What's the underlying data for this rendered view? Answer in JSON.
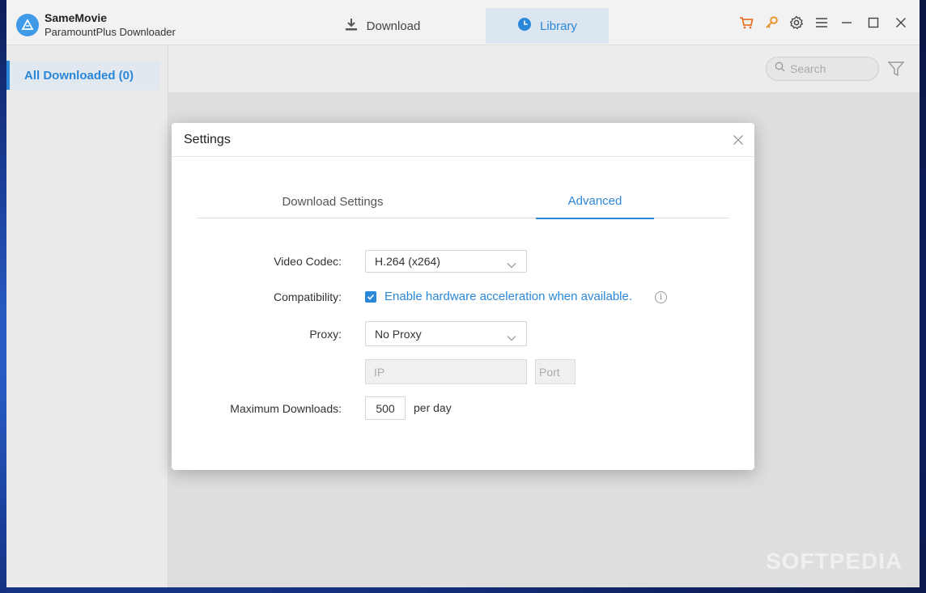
{
  "app": {
    "name": "SameMovie",
    "subtitle": "ParamountPlus Downloader"
  },
  "nav": {
    "download": "Download",
    "library": "Library"
  },
  "toolbar_icons": [
    "cart-icon",
    "key-icon",
    "gear-icon",
    "menu-icon",
    "minimize-icon",
    "maximize-icon",
    "close-icon"
  ],
  "sidebar": {
    "all_downloaded": "All Downloaded (0)"
  },
  "search": {
    "placeholder": "Search"
  },
  "settings": {
    "title": "Settings",
    "tabs": [
      "Download Settings",
      "Advanced"
    ],
    "active_tab": "Advanced",
    "video_codec_label": "Video Codec:",
    "video_codec_value": "H.264 (x264)",
    "compatibility_label": "Compatibility:",
    "hw_accel_text": "Enable hardware acceleration when available.",
    "hw_accel_checked": true,
    "proxy_label": "Proxy:",
    "proxy_value": "No Proxy",
    "ip_placeholder": "IP",
    "port_placeholder": "Port",
    "max_downloads_label": "Maximum Downloads:",
    "max_downloads_value": "500",
    "per_day": "per day"
  },
  "watermark": "SOFTPEDIA",
  "colors": {
    "accent": "#2b87d8",
    "cart": "#e8742a",
    "key": "#e8952a"
  }
}
